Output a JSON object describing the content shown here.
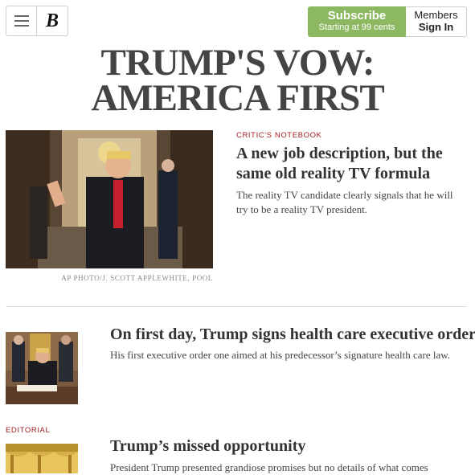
{
  "header": {
    "subscribe_label": "Subscribe",
    "subscribe_sub": "Starting at 99 cents",
    "members_label": "Members",
    "signin_label": "Sign In",
    "logo_glyph": "B",
    "subscribe_color": "#8db862"
  },
  "banner": {
    "line1": "TRUMP'S VOW:",
    "line2": "AMERICA FIRST"
  },
  "stories": [
    {
      "kicker": "CRITIC'S NOTEBOOK",
      "title": "A new job description, but the same old reality TV formula",
      "dek": "The reality TV candidate clearly signals that he will try to be a reality TV president.",
      "credit": "AP PHOTO/J. SCOTT APPLEWHITE, POOL"
    },
    {
      "title": "On first day, Trump signs health care executive order",
      "dek": "His first executive order one aimed at his predecessor’s signature health care law."
    },
    {
      "kicker": "EDITORIAL",
      "title": "Trump’s missed opportunity",
      "dek": "President Trump presented grandiose promises but no details of what comes"
    }
  ],
  "colors": {
    "kicker": "#a32020",
    "headline": "#444444"
  }
}
